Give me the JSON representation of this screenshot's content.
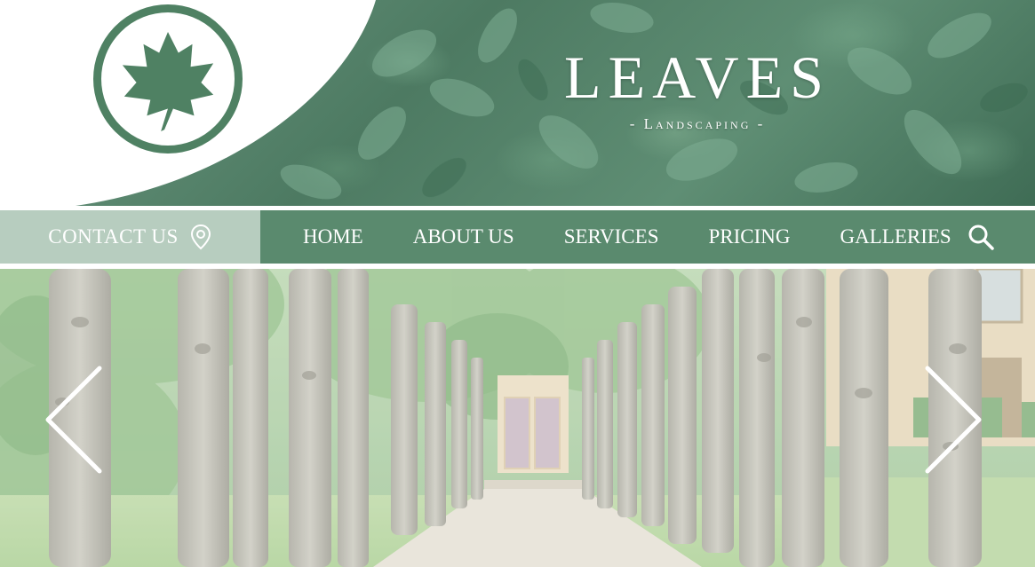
{
  "brand": {
    "title": "LEAVES",
    "subtitle": "- Landscaping -",
    "logo_icon": "leaf-icon",
    "colors": {
      "primary": "#5a8a6e",
      "logo": "#4f8163",
      "contact_bg": "#b7cdbf"
    }
  },
  "nav": {
    "contact_label": "CONTACT US",
    "contact_icon": "location-pin-icon",
    "items": [
      {
        "label": "HOME"
      },
      {
        "label": "ABOUT US"
      },
      {
        "label": "SERVICES"
      },
      {
        "label": "PRICING"
      },
      {
        "label": "GALLERIES"
      }
    ],
    "search_icon": "search-icon"
  },
  "hero": {
    "prev_icon": "chevron-left-icon",
    "next_icon": "chevron-right-icon"
  }
}
